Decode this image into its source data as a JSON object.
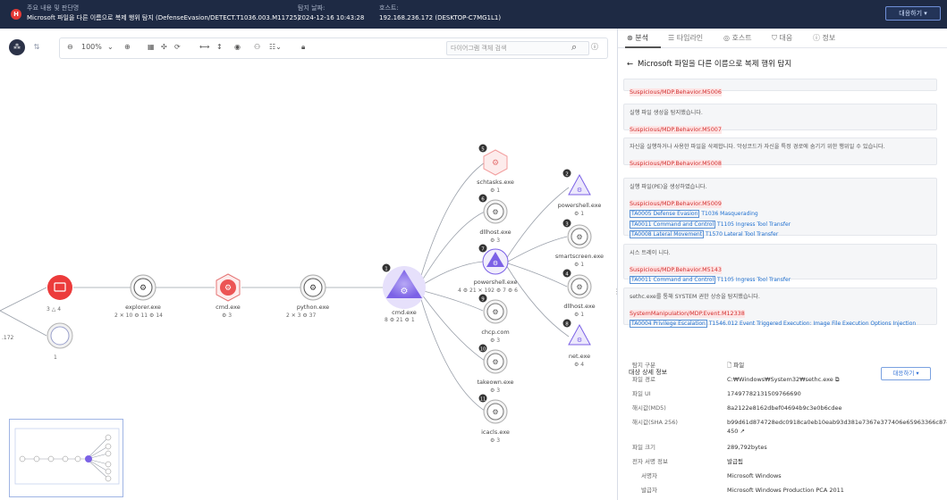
{
  "header": {
    "logo": "H",
    "title_key": "주요 내용 및 판단명",
    "title_value": "Microsoft 파일을 다른 이름으로 복제 행위 탐지 (DefenseEvasion/DETECT.T1036.003.M11725)",
    "time_key": "탐지 날짜:",
    "time_value": "2024-12-16 10:43:28",
    "host_key": "호스트:",
    "host_value": "192.168.236.172 (DESKTOP-C7MG1L1)",
    "respond_label": "대응하기 ▾"
  },
  "toolbar": {
    "zoom": "100%",
    "search_placeholder": "다이어그램 객체 검색"
  },
  "graph": {
    "left_ip": ".172",
    "nodes": {
      "root_meta": "3 △ 4",
      "root2_meta": "1",
      "explorer": {
        "name": "explorer.exe",
        "meta": "2 ✕ 10 ⚙ 11 ⚙ 14"
      },
      "cmd1": {
        "name": "cmd.exe",
        "meta": "⚙ 3"
      },
      "python": {
        "name": "python.exe",
        "meta": "2 ✕ 3 ⚙ 37"
      },
      "cmd_main": {
        "name": "cmd.exe",
        "meta": "8 ⚙ 21 ⚙ 1",
        "badge": "1"
      },
      "schtasks": {
        "name": "schtasks.exe",
        "meta": "⚙ 1",
        "badge": "5"
      },
      "dllhost1": {
        "name": "dllhost.exe",
        "meta": "⚙ 3",
        "badge": "6"
      },
      "powershell_mid": {
        "name": "powershell.exe",
        "meta": "4 ⚙ 21 ✕ 192 ⚙ 7 ⚙ 6",
        "badge": "7"
      },
      "chcp": {
        "name": "chcp.com",
        "meta": "⚙ 3",
        "badge": "9"
      },
      "takeown": {
        "name": "takeown.exe",
        "meta": "⚙ 3",
        "badge": "10"
      },
      "icacls": {
        "name": "icacls.exe",
        "meta": "⚙ 3",
        "badge": "11"
      },
      "powershell_r": {
        "name": "powershell.exe",
        "meta": "⚙ 1",
        "badge": "2"
      },
      "smartscreen": {
        "name": "smartscreen.exe",
        "meta": "⚙ 1",
        "badge": "3"
      },
      "dllhost2": {
        "name": "dllhost.exe",
        "meta": "⚙ 1",
        "badge": "4"
      },
      "net": {
        "name": "net.exe",
        "meta": "⚙ 4",
        "badge": "8"
      }
    }
  },
  "panel": {
    "tabs": [
      "분석",
      "타임라인",
      "호스트",
      "대응",
      "정보"
    ],
    "title": "Microsoft 파일을 다른 이름으로 복제 행위 탐지",
    "cards": [
      {
        "desc": "",
        "rule": "Suspicious/MDP.Behavior.M5006",
        "mitre": []
      },
      {
        "desc": "실행 파일 생성을 탐지했습니다.",
        "rule": "Suspicious/MDP.Behavior.M5007",
        "mitre": []
      },
      {
        "desc": "자신을 실행하거나 사용한 파일을 삭제합니다. 악성코드가 자신을 특정 경로에 숨기기 위한 행위일 수 있습니다.",
        "rule": "Suspicious/MDP.Behavior.M5008",
        "mitre": []
      },
      {
        "desc": "실행 파일(PE)을 생성하였습니다.",
        "rule": "Suspicious/MDP.Behavior.M5009",
        "mitre": [
          {
            "tactic": "TA0005 Defense Evasion",
            "tech": "T1036 Masquerading"
          },
          {
            "tactic": "TA0011 Command and Control",
            "tech": "T1105 Ingress Tool Transfer"
          },
          {
            "tactic": "TA0008 Lateral Movement",
            "tech": "T1570 Lateral Tool Transfer"
          }
        ]
      },
      {
        "desc": "시스 트레이 니다.",
        "rule": "Suspicious/MDP.Behavior.M5143",
        "mitre": [
          {
            "tactic": "TA0011 Command and Control",
            "tech": "T1105 Ingress Tool Transfer"
          }
        ]
      },
      {
        "desc": "sethc.exe를 통해 SYSTEM 권한 상승을 탐지했습니다.",
        "rule": "SystemManipulation/MDP.Event.M12338",
        "mitre": [
          {
            "tactic": "TA0004 Privilege Escalation",
            "tech": "T1546.012 Event Triggered Execution: Image File Execution Options Injection"
          }
        ]
      }
    ],
    "section_title": "대상 상세 정보",
    "respond_label": "대응하기 ▾",
    "details": [
      {
        "k": "탐지 구분",
        "v": "파일"
      },
      {
        "k": "파일 경로",
        "v": "C:₩Windows₩System32₩sethc.exe"
      },
      {
        "k": "파일 UI",
        "v": "17497782131509766690"
      },
      {
        "k": "해시값(MD5)",
        "v": "8a2122e8162dbef04694b9c3e0b6cdee"
      },
      {
        "k": "해시값(SHA 256)",
        "v": "b99d61d874728edc0918ca0eb10eab93d381e7367e377406e65963366c874450"
      },
      {
        "k": "파일 크기",
        "v": "289,792bytes"
      },
      {
        "k": "전자 서명 정보",
        "v": "발급됨"
      },
      {
        "k": "서명자",
        "v": "Microsoft Windows"
      },
      {
        "k": "발급자",
        "v": "Microsoft Windows Production PCA 2011"
      }
    ]
  }
}
